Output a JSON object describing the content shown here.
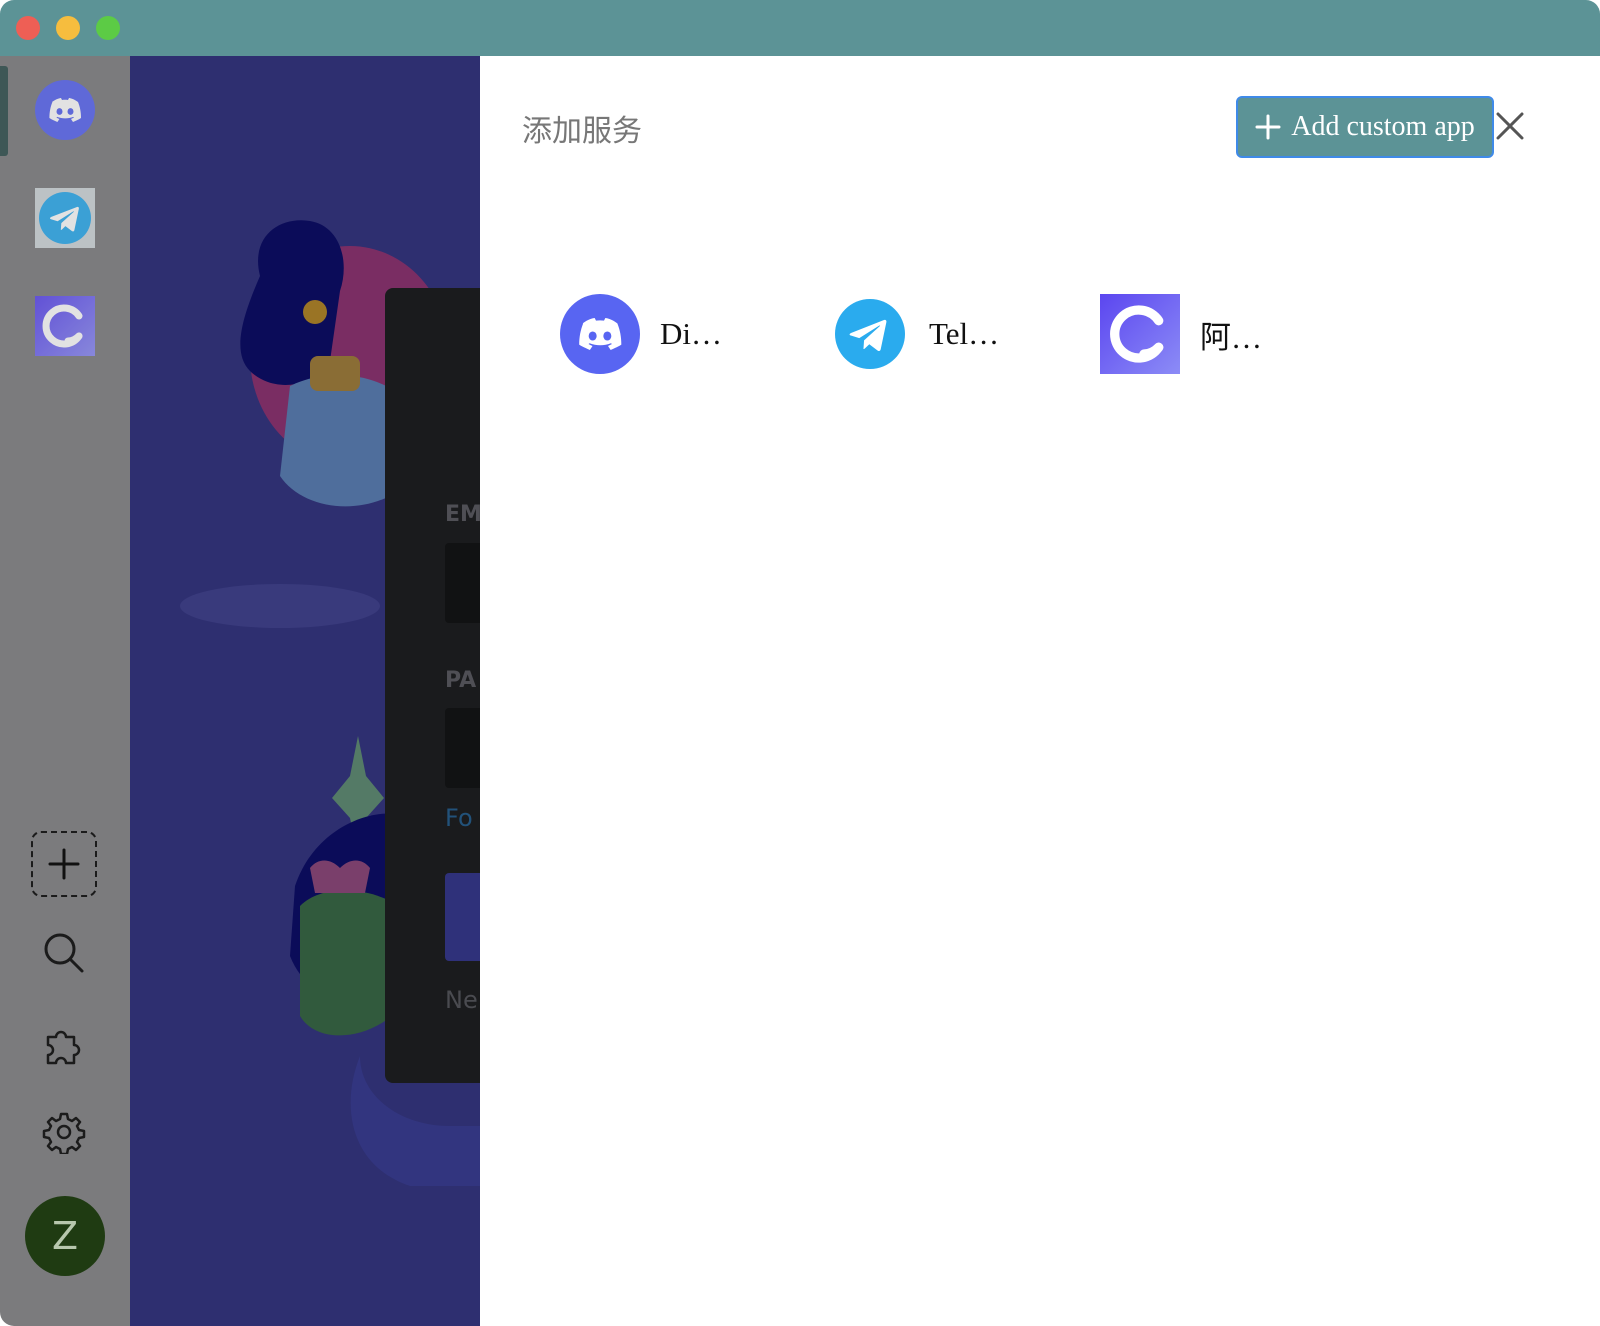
{
  "window": {
    "controls": [
      "close",
      "minimize",
      "maximize"
    ]
  },
  "sidebar": {
    "services": [
      {
        "icon": "discord-icon",
        "name": "Discord"
      },
      {
        "icon": "telegram-icon",
        "name": "Telegram"
      },
      {
        "icon": "aliyun-icon",
        "name": "阿里云盘"
      }
    ],
    "tools": [
      "add-service",
      "search",
      "extensions",
      "settings"
    ],
    "avatar_letter": "Z"
  },
  "background_login": {
    "email_label": "EM",
    "password_label": "PA",
    "forgot_link": "Fo",
    "register_note": "Ne"
  },
  "dialog": {
    "title": "添加服务",
    "add_custom_label": "Add custom app",
    "services": [
      {
        "label": "Di…",
        "icon": "discord-icon"
      },
      {
        "label": "Tel…",
        "icon": "telegram-icon"
      },
      {
        "label": "阿…",
        "icon": "aliyun-icon"
      }
    ]
  },
  "colors": {
    "titlebar": "#5c9396",
    "accent": "#5c9396",
    "sidebar": "#7b7b7d",
    "discord": "#5865f2",
    "telegram": "#2aabee"
  }
}
